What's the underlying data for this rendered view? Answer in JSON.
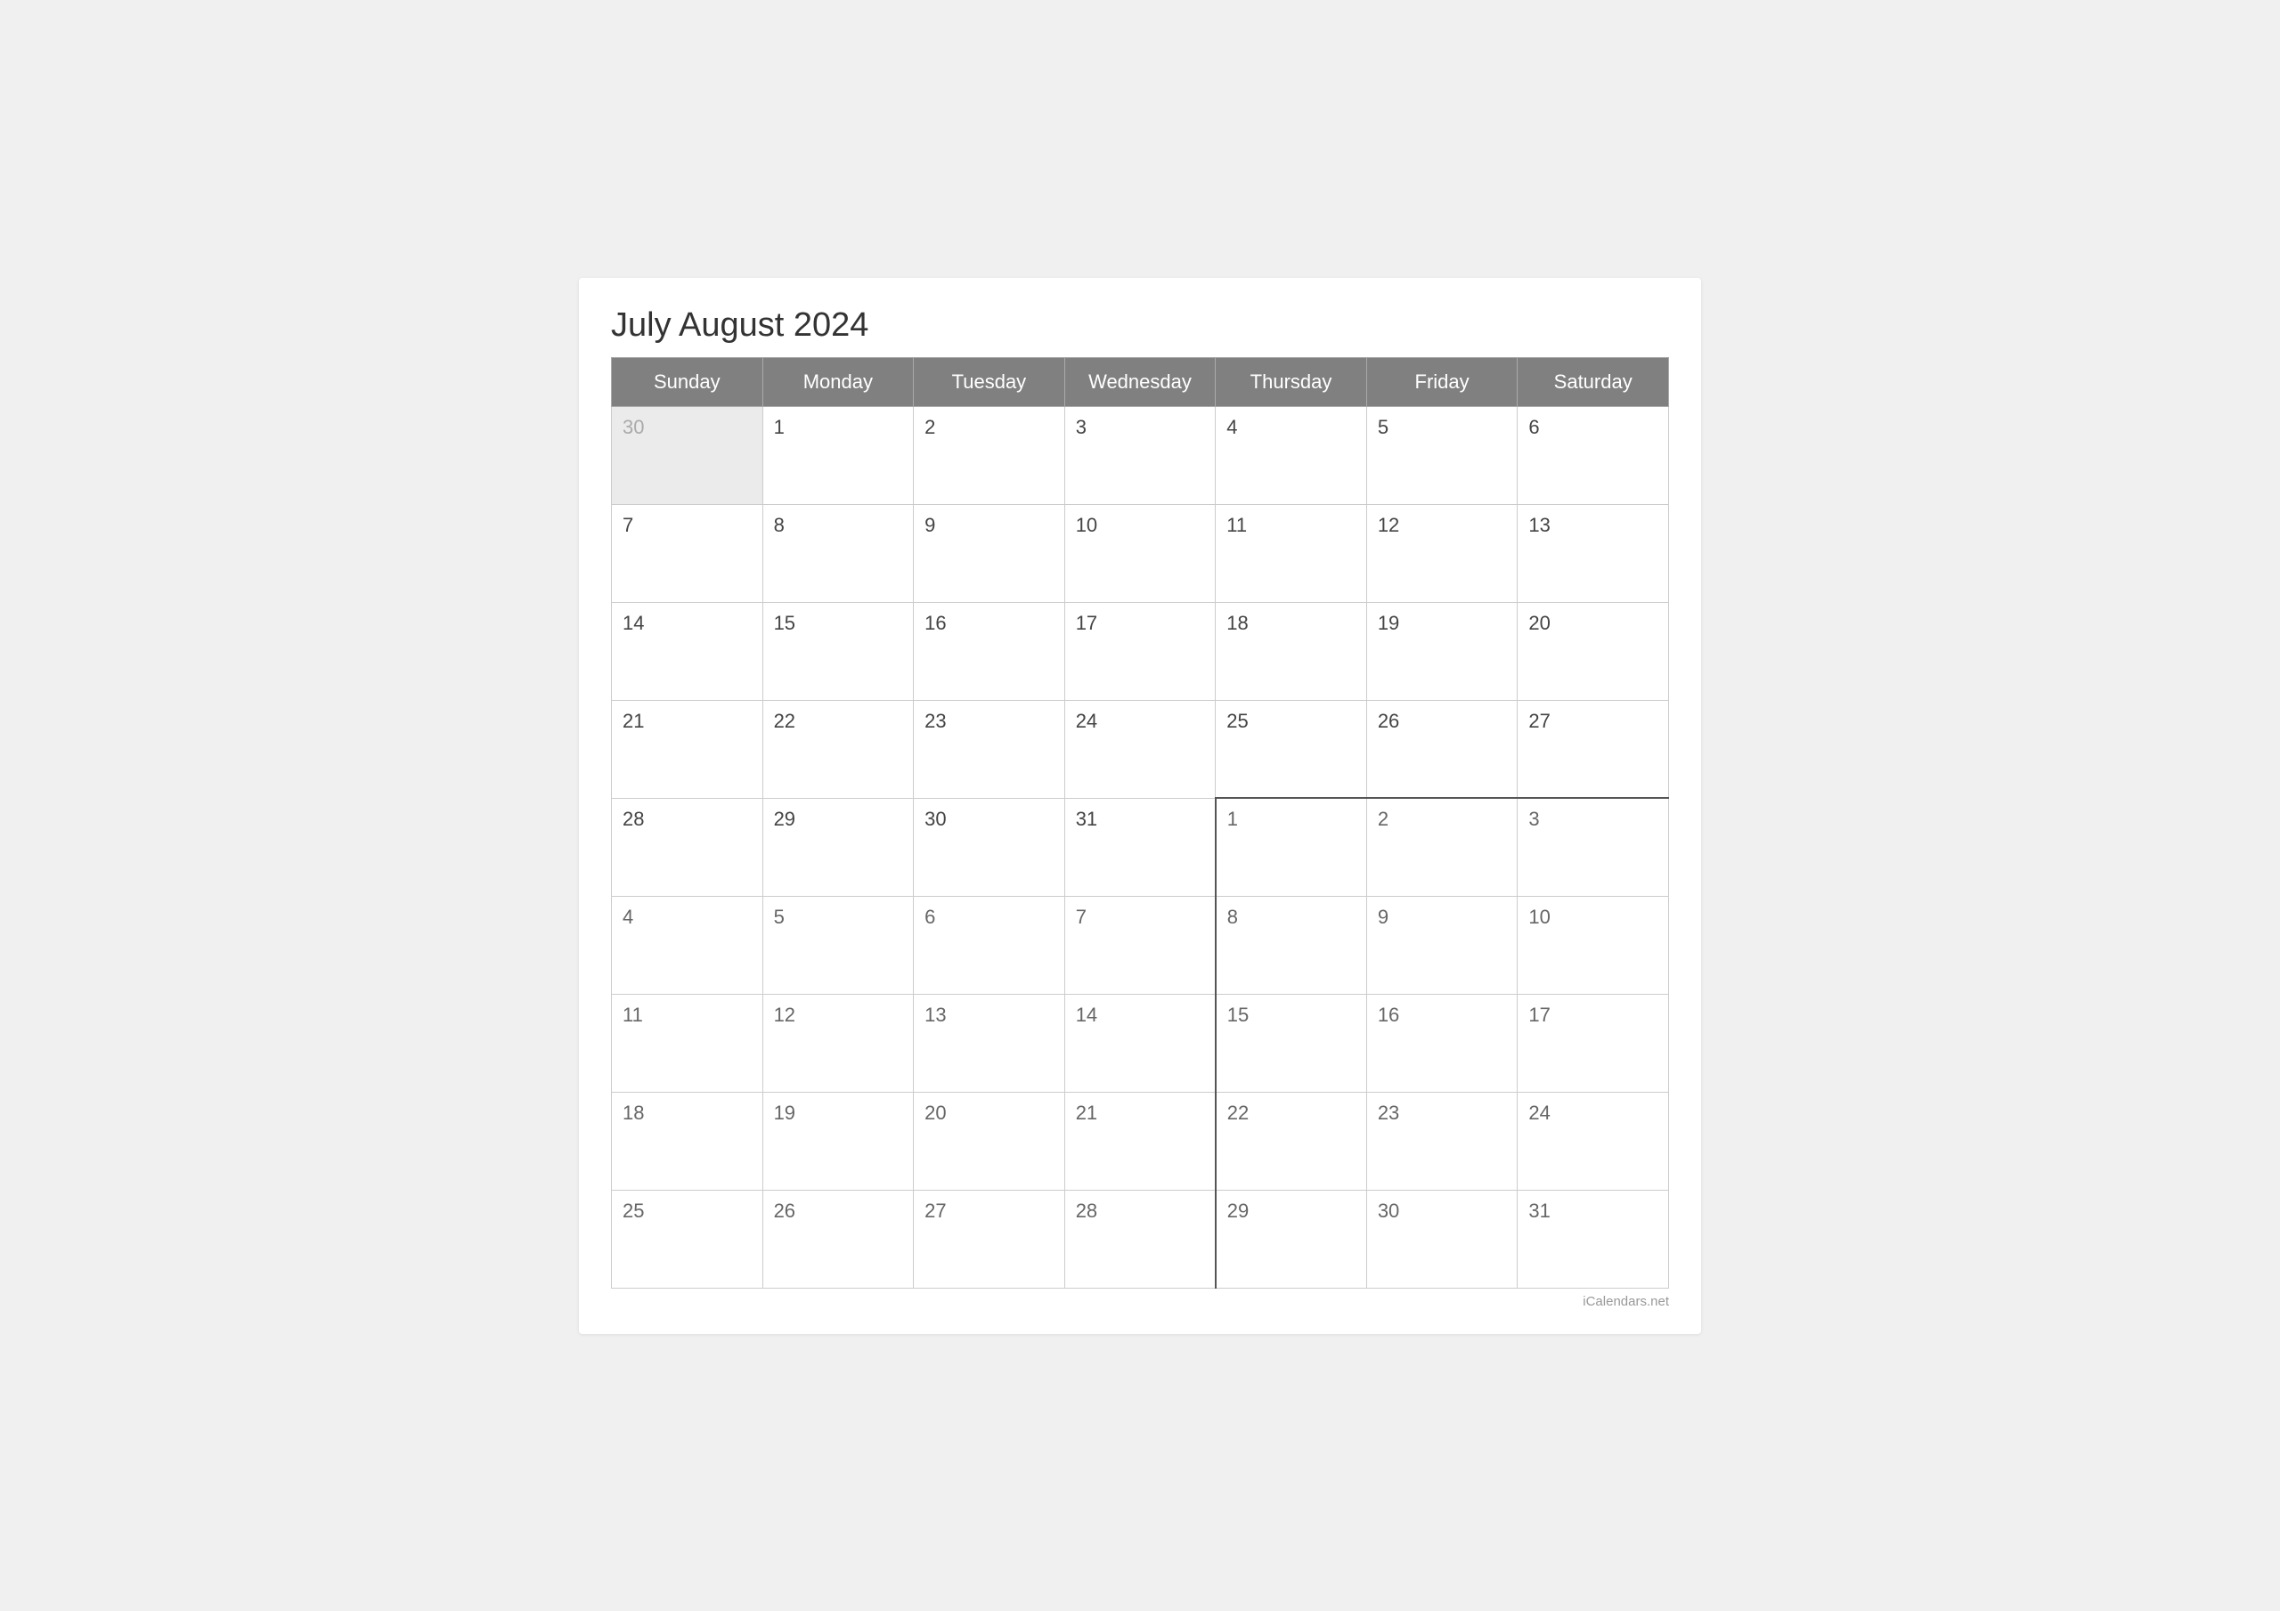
{
  "title": "July August 2024",
  "watermark": "iCalendars.net",
  "headers": [
    "Sunday",
    "Monday",
    "Tuesday",
    "Wednesday",
    "Thursday",
    "Friday",
    "Saturday"
  ],
  "weeks": [
    [
      {
        "day": "30",
        "type": "prev-month"
      },
      {
        "day": "1",
        "type": "current"
      },
      {
        "day": "2",
        "type": "current"
      },
      {
        "day": "3",
        "type": "current"
      },
      {
        "day": "4",
        "type": "current"
      },
      {
        "day": "5",
        "type": "current"
      },
      {
        "day": "6",
        "type": "current"
      }
    ],
    [
      {
        "day": "7",
        "type": "current"
      },
      {
        "day": "8",
        "type": "current"
      },
      {
        "day": "9",
        "type": "current"
      },
      {
        "day": "10",
        "type": "current"
      },
      {
        "day": "11",
        "type": "current"
      },
      {
        "day": "12",
        "type": "current"
      },
      {
        "day": "13",
        "type": "current"
      }
    ],
    [
      {
        "day": "14",
        "type": "current"
      },
      {
        "day": "15",
        "type": "current"
      },
      {
        "day": "16",
        "type": "current"
      },
      {
        "day": "17",
        "type": "current"
      },
      {
        "day": "18",
        "type": "current"
      },
      {
        "day": "19",
        "type": "current"
      },
      {
        "day": "20",
        "type": "current"
      }
    ],
    [
      {
        "day": "21",
        "type": "current"
      },
      {
        "day": "22",
        "type": "current"
      },
      {
        "day": "23",
        "type": "current"
      },
      {
        "day": "24",
        "type": "current"
      },
      {
        "day": "25",
        "type": "current"
      },
      {
        "day": "26",
        "type": "current"
      },
      {
        "day": "27",
        "type": "current"
      }
    ],
    [
      {
        "day": "28",
        "type": "current"
      },
      {
        "day": "29",
        "type": "current"
      },
      {
        "day": "30",
        "type": "current"
      },
      {
        "day": "31",
        "type": "current"
      },
      {
        "day": "1",
        "type": "next-month month-boundary-top month-boundary-left"
      },
      {
        "day": "2",
        "type": "next-month month-boundary-top"
      },
      {
        "day": "3",
        "type": "next-month month-boundary-top"
      }
    ],
    [
      {
        "day": "4",
        "type": "next-month"
      },
      {
        "day": "5",
        "type": "next-month"
      },
      {
        "day": "6",
        "type": "next-month"
      },
      {
        "day": "7",
        "type": "next-month"
      },
      {
        "day": "8",
        "type": "next-month month-boundary-left"
      },
      {
        "day": "9",
        "type": "next-month"
      },
      {
        "day": "10",
        "type": "next-month"
      }
    ],
    [
      {
        "day": "11",
        "type": "next-month"
      },
      {
        "day": "12",
        "type": "next-month"
      },
      {
        "day": "13",
        "type": "next-month"
      },
      {
        "day": "14",
        "type": "next-month"
      },
      {
        "day": "15",
        "type": "next-month month-boundary-left"
      },
      {
        "day": "16",
        "type": "next-month"
      },
      {
        "day": "17",
        "type": "next-month"
      }
    ],
    [
      {
        "day": "18",
        "type": "next-month"
      },
      {
        "day": "19",
        "type": "next-month"
      },
      {
        "day": "20",
        "type": "next-month"
      },
      {
        "day": "21",
        "type": "next-month"
      },
      {
        "day": "22",
        "type": "next-month month-boundary-left"
      },
      {
        "day": "23",
        "type": "next-month"
      },
      {
        "day": "24",
        "type": "next-month"
      }
    ],
    [
      {
        "day": "25",
        "type": "next-month"
      },
      {
        "day": "26",
        "type": "next-month"
      },
      {
        "day": "27",
        "type": "next-month"
      },
      {
        "day": "28",
        "type": "next-month"
      },
      {
        "day": "29",
        "type": "next-month month-boundary-left"
      },
      {
        "day": "30",
        "type": "next-month"
      },
      {
        "day": "31",
        "type": "next-month"
      }
    ]
  ]
}
